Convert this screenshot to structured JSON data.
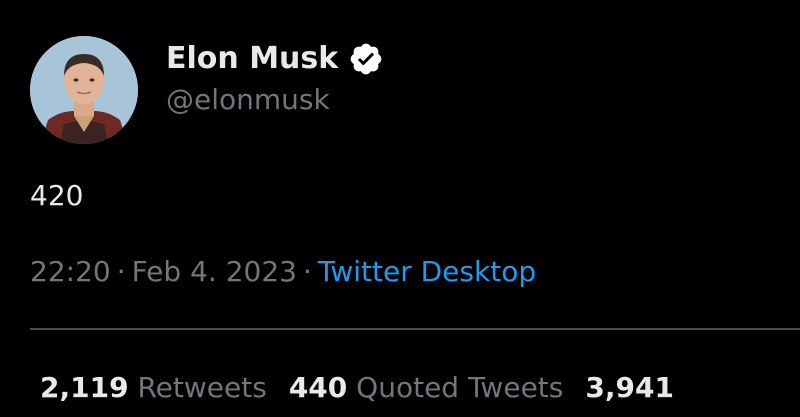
{
  "author": {
    "display_name": "Elon Musk",
    "handle": "@elonmusk",
    "verified_icon": "verified-badge-icon",
    "avatar_icon": "profile-photo"
  },
  "tweet": {
    "text": "420",
    "time": "22:20",
    "date": "Feb 4. 2023",
    "separator": "·",
    "source": "Twitter Desktop"
  },
  "stats": {
    "retweets_count": "2,119",
    "retweets_label": "Retweets",
    "quoted_count": "440",
    "quoted_label": "Quoted Tweets",
    "likes_count": "3,941"
  },
  "colors": {
    "background": "#000000",
    "primary_text": "#e7e9ea",
    "secondary_text": "#71767b",
    "link": "#1d9bf0",
    "divider": "#4a4d51"
  }
}
